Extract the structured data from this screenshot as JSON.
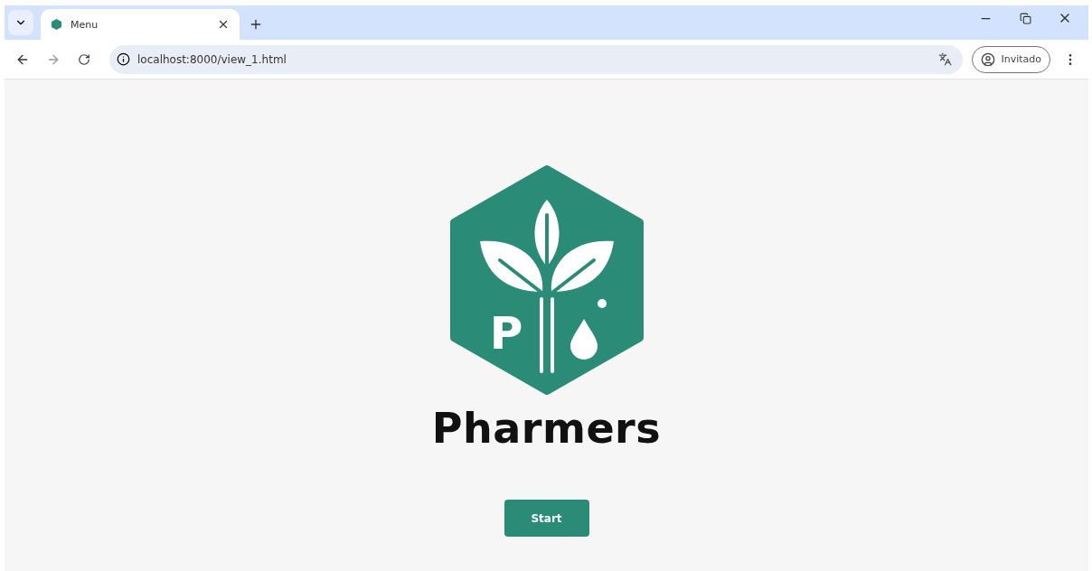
{
  "browser": {
    "tab": {
      "title": "Menu",
      "selected": true
    },
    "address": "localhost:8000/view_1.html",
    "profile": "Invitado"
  },
  "page": {
    "logo": {
      "letter": "P"
    },
    "title": "Pharmers",
    "button": "Start"
  }
}
